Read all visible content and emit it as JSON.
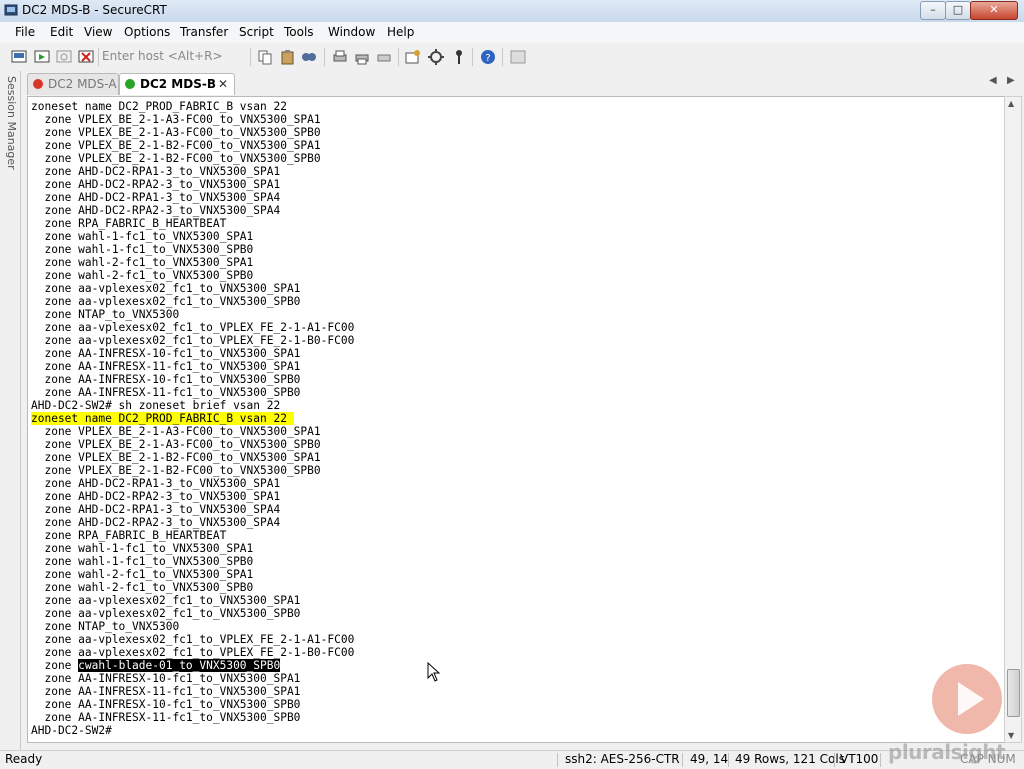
{
  "window": {
    "title": "DC2 MDS-B - SecureCRT",
    "controls": {
      "minimize": "–",
      "maximize": "□",
      "close": "✕"
    }
  },
  "menu": [
    "File",
    "Edit",
    "View",
    "Options",
    "Transfer",
    "Script",
    "Tools",
    "Window",
    "Help"
  ],
  "toolbar": {
    "host_placeholder": "Enter host <Alt+R>",
    "icons": [
      "connect-icon",
      "quick-connect-icon",
      "reconnect-icon",
      "disconnect-icon",
      "copy-icon",
      "paste-icon",
      "find-icon",
      "print-icon",
      "print-selection-icon",
      "print-setup-icon",
      "session-options-icon",
      "global-options-icon",
      "keymap-icon",
      "help-icon",
      "sftp-icon"
    ]
  },
  "session_manager": {
    "label": "Session Manager"
  },
  "tabs": [
    {
      "label": "DC2 MDS-A",
      "active": false,
      "status": "disconnected"
    },
    {
      "label": "DC2 MDS-B",
      "active": true,
      "status": "connected",
      "close": "✕"
    }
  ],
  "tab_nav": {
    "prev": "◀",
    "next": "▶"
  },
  "terminal": {
    "lines": [
      "zoneset name DC2_PROD_FABRIC_B vsan 22",
      "  zone VPLEX_BE_2-1-A3-FC00_to_VNX5300_SPA1",
      "  zone VPLEX_BE_2-1-A3-FC00_to_VNX5300_SPB0",
      "  zone VPLEX_BE_2-1-B2-FC00_to_VNX5300_SPA1",
      "  zone VPLEX_BE_2-1-B2-FC00_to_VNX5300_SPB0",
      "  zone AHD-DC2-RPA1-3_to_VNX5300_SPA1",
      "  zone AHD-DC2-RPA2-3_to_VNX5300_SPA1",
      "  zone AHD-DC2-RPA1-3_to_VNX5300_SPA4",
      "  zone AHD-DC2-RPA2-3_to_VNX5300_SPA4",
      "  zone RPA_FABRIC_B_HEARTBEAT",
      "  zone wahl-1-fc1_to_VNX5300_SPA1",
      "  zone wahl-1-fc1_to_VNX5300_SPB0",
      "  zone wahl-2-fc1_to_VNX5300_SPA1",
      "  zone wahl-2-fc1_to_VNX5300_SPB0",
      "  zone aa-vplexesx02_fc1_to_VNX5300_SPA1",
      "  zone aa-vplexesx02_fc1_to_VNX5300_SPB0",
      "  zone NTAP_to_VNX5300",
      "  zone aa-vplexesx02_fc1_to_VPLEX_FE_2-1-A1-FC00",
      "  zone aa-vplexesx02_fc1_to_VPLEX_FE_2-1-B0-FC00",
      "  zone AA-INFRESX-10-fc1_to_VNX5300_SPA1",
      "  zone AA-INFRESX-11-fc1_to_VNX5300_SPA1",
      "  zone AA-INFRESX-10-fc1_to_VNX5300_SPB0",
      "  zone AA-INFRESX-11-fc1_to_VNX5300_SPB0",
      "AHD-DC2-SW2# sh zoneset brief vsan 22",
      "zoneset name DC2_PROD_FABRIC_B vsan 22",
      "  zone VPLEX_BE_2-1-A3-FC00_to_VNX5300_SPA1",
      "  zone VPLEX_BE_2-1-A3-FC00_to_VNX5300_SPB0",
      "  zone VPLEX_BE_2-1-B2-FC00_to_VNX5300_SPA1",
      "  zone VPLEX_BE_2-1-B2-FC00_to_VNX5300_SPB0",
      "  zone AHD-DC2-RPA1-3_to_VNX5300_SPA1",
      "  zone AHD-DC2-RPA2-3_to_VNX5300_SPA1",
      "  zone AHD-DC2-RPA1-3_to_VNX5300_SPA4",
      "  zone AHD-DC2-RPA2-3_to_VNX5300_SPA4",
      "  zone RPA_FABRIC_B_HEARTBEAT",
      "  zone wahl-1-fc1_to_VNX5300_SPA1",
      "  zone wahl-1-fc1_to_VNX5300_SPB0",
      "  zone wahl-2-fc1_to_VNX5300_SPA1",
      "  zone wahl-2-fc1_to_VNX5300_SPB0",
      "  zone aa-vplexesx02_fc1_to_VNX5300_SPA1",
      "  zone aa-vplexesx02_fc1_to_VNX5300_SPB0",
      "  zone NTAP_to_VNX5300",
      "  zone aa-vplexesx02_fc1_to_VPLEX_FE_2-1-A1-FC00",
      "  zone aa-vplexesx02_fc1_to_VPLEX_FE_2-1-B0-FC00",
      "  zone cwahl-blade-01_to_VNX5300_SPB0",
      "  zone AA-INFRESX-10-fc1_to_VNX5300_SPA1",
      "  zone AA-INFRESX-11-fc1_to_VNX5300_SPA1",
      "  zone AA-INFRESX-10-fc1_to_VNX5300_SPB0",
      "  zone AA-INFRESX-11-fc1_to_VNX5300_SPB0",
      "AHD-DC2-SW2#"
    ],
    "highlight_line_index": 24,
    "highlight_color": "#ffff00",
    "selected_line_index": 43,
    "selected_prefix": "  zone ",
    "selected_text": "cwahl-blade-01_to_VNX5300_SPB0"
  },
  "statusbar": {
    "ready": "Ready",
    "cipher": "ssh2: AES-256-CTR",
    "cursor_pos": "49, 14",
    "dimensions": "49 Rows, 121 Cols",
    "emulation": "VT100",
    "caps_num": "CAP NUM"
  },
  "watermark": {
    "text": "pluralsight"
  },
  "colors": {
    "play_button": "#e9a08f",
    "highlight": "#ffff00",
    "selection_bg": "#000000"
  }
}
